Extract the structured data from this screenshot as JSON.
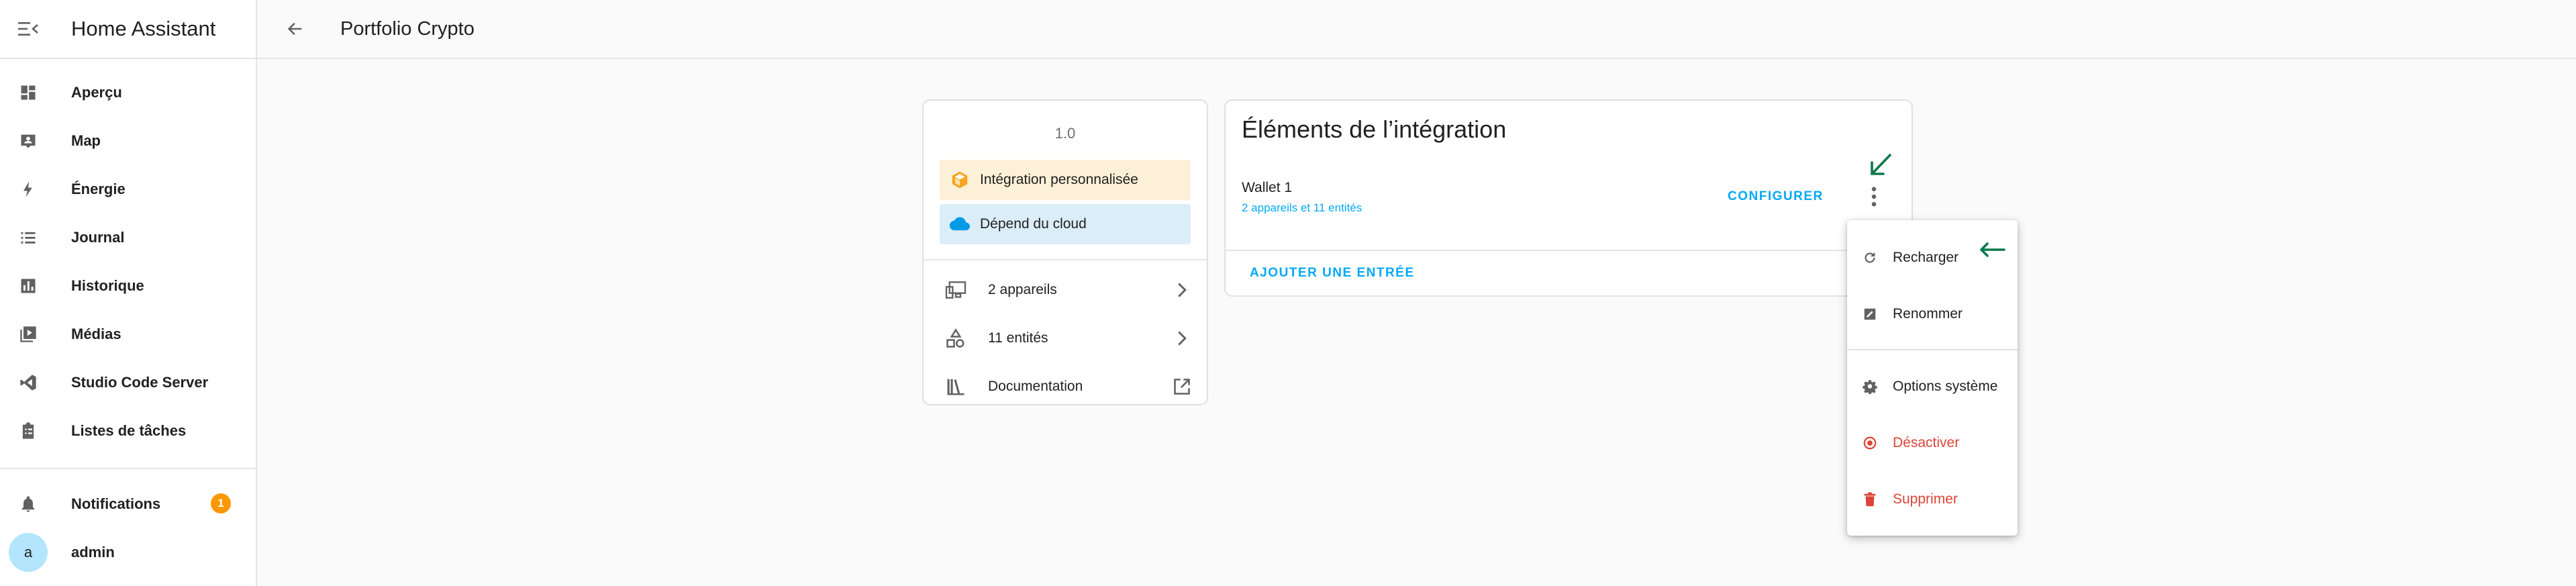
{
  "sidebar": {
    "title": "Home Assistant",
    "items": [
      {
        "label": "Aperçu",
        "icon": "dashboard-icon"
      },
      {
        "label": "Map",
        "icon": "map-icon"
      },
      {
        "label": "Énergie",
        "icon": "lightning-icon"
      },
      {
        "label": "Journal",
        "icon": "list-icon"
      },
      {
        "label": "Historique",
        "icon": "chart-icon"
      },
      {
        "label": "Médias",
        "icon": "media-icon"
      },
      {
        "label": "Studio Code Server",
        "icon": "vscode-icon"
      },
      {
        "label": "Listes de tâches",
        "icon": "clipboard-icon"
      }
    ],
    "notifications": {
      "label": "Notifications",
      "count": "1"
    },
    "user": {
      "initial": "a",
      "name": "admin"
    }
  },
  "topbar": {
    "title": "Portfolio Crypto"
  },
  "info_card": {
    "version": "1.0",
    "custom_label": "Intégration personnalisée",
    "cloud_label": "Dépend du cloud",
    "devices_label": "2 appareils",
    "entities_label": "11 entités",
    "docs_label": "Documentation"
  },
  "entries_card": {
    "title": "Éléments de l’intégration",
    "entry_name": "Wallet 1",
    "entry_sub": "2 appareils et 11 entités",
    "configure_label": "CONFIGURER",
    "add_entry_label": "AJOUTER UNE ENTRÉE"
  },
  "menu": {
    "reload": "Recharger",
    "rename": "Renommer",
    "system_options": "Options système",
    "disable": "Désactiver",
    "delete": "Supprimer"
  },
  "colors": {
    "accent": "#03a9f4",
    "danger": "#db4437",
    "annotation_arrow": "#0a7a4a",
    "badge": "#ff9800"
  }
}
